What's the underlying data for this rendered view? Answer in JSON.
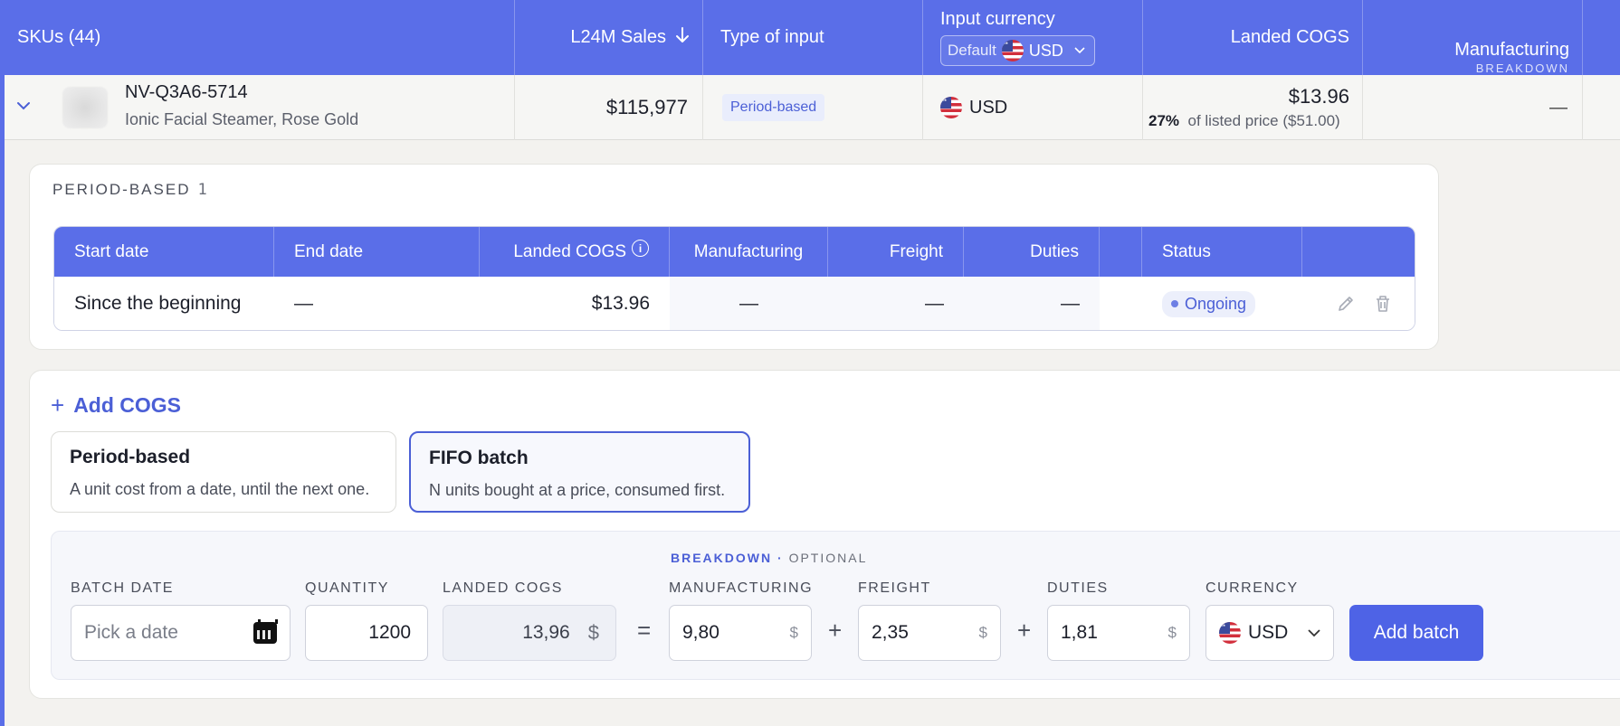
{
  "colors": {
    "accent": "#5a6ee8",
    "accent_dark": "#4b5fd6",
    "button": "#4e63e6",
    "page_bg": "#f3f2ef"
  },
  "header": {
    "skus": "SKUs (44)",
    "sales": "L24M Sales",
    "sales_sort_icon": "arrow-down-icon",
    "type": "Type of input",
    "currency": "Input currency",
    "currency_default": "Default",
    "currency_value": "USD",
    "landed": "Landed COGS",
    "manufacturing": "Manufacturing",
    "manufacturing_sub": "BREAKDOWN"
  },
  "sku_row": {
    "sku": "NV-Q3A6-5714",
    "name": "Ionic Facial Steamer, Rose Gold",
    "sales": "$115,977",
    "type": "Period-based",
    "currency": "USD",
    "landed": "$13.96",
    "landed_pct": "27%",
    "landed_note": "of listed price ($51.00)",
    "manufacturing": "—"
  },
  "period_card": {
    "title": "PERIOD-BASED",
    "count": "1",
    "columns": [
      "Start date",
      "End date",
      "Landed COGS",
      "Manufacturing",
      "Freight",
      "Duties",
      "Status"
    ],
    "row": {
      "start": "Since the beginning",
      "end": "—",
      "landed": "$13.96",
      "manufacturing": "—",
      "freight": "—",
      "duties": "—",
      "status": "Ongoing"
    }
  },
  "add_card": {
    "title": "Add COGS",
    "options": [
      {
        "title": "Period-based",
        "desc": "A unit cost from a date, until the next one."
      },
      {
        "title": "FIFO batch",
        "desc": "N units bought at a price, consumed first."
      }
    ],
    "selected_option": "FIFO batch",
    "form": {
      "breakdown": "BREAKDOWN",
      "optional": "OPTIONAL",
      "batch_date_label": "BATCH DATE",
      "batch_date_placeholder": "Pick a date",
      "quantity_label": "QUANTITY",
      "quantity": "1200",
      "landed_label": "LANDED COGS",
      "landed": "13,96",
      "manu_label": "MANUFACTURING",
      "manu": "9,80",
      "freight_label": "FREIGHT",
      "freight": "2,35",
      "duties_label": "DUTIES",
      "duties": "1,81",
      "currency_label": "CURRENCY",
      "currency": "USD",
      "unit": "$",
      "eq": "=",
      "plus": "+",
      "submit": "Add batch"
    }
  }
}
